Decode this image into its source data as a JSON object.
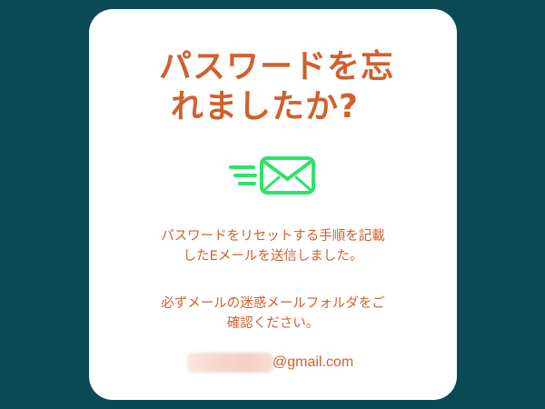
{
  "dialog": {
    "title_line1": "パスワードを忘",
    "title_line2": "れましたか?",
    "icon": "mail-sent-icon",
    "description_line1": "パスワードをリセットする手順を記載",
    "description_line2": "したEメールを送信しました。",
    "spam_notice_line1": "必ずメールの迷惑メールフォルダをご",
    "spam_notice_line2": "確認ください。",
    "email_domain": "@gmail.com"
  },
  "colors": {
    "background": "#0a4a55",
    "card": "#ffffff",
    "accent_text": "#d1602d",
    "icon_green": "#2ee36a"
  }
}
